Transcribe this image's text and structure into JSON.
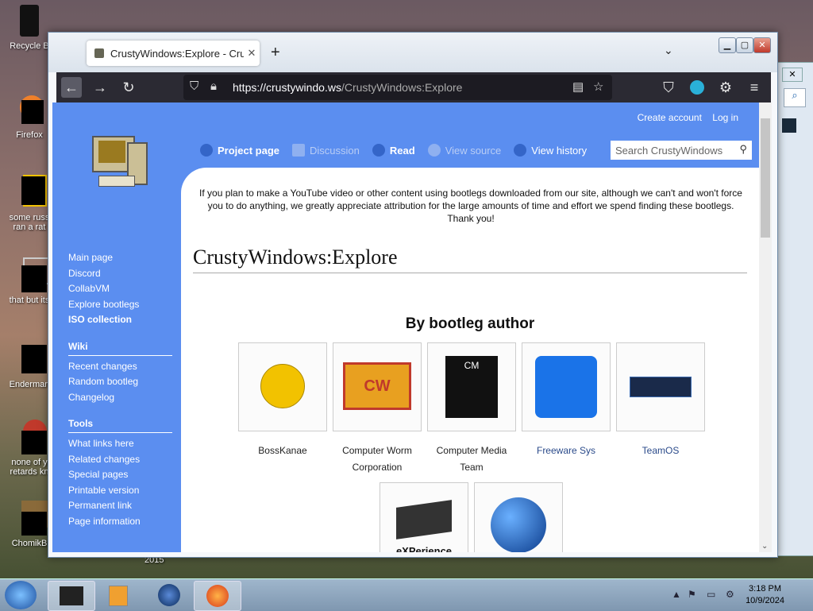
{
  "desktop": {
    "icons": [
      {
        "label": "Recycle B"
      },
      {
        "label": "Firefox"
      },
      {
        "label": "some russ ran a rat"
      },
      {
        "label": "that but its"
      },
      {
        "label": "Enderman"
      },
      {
        "label": "none of y retards kn"
      },
      {
        "label": "ChomikB"
      }
    ],
    "year_label": "2015"
  },
  "browser": {
    "tab_title": "CrustyWindows:Explore - Crust",
    "tab_close": "✕",
    "new_tab": "+",
    "list_tabs": "⌄",
    "url_host": "https://crustywindo.ws",
    "url_path": "/CrustyWindows:Explore"
  },
  "site": {
    "top_links": [
      "Create account",
      "Log in"
    ],
    "page_tabs": [
      {
        "label": "Project page"
      },
      {
        "label": "Discussion"
      },
      {
        "label": "Read"
      },
      {
        "label": "View source"
      },
      {
        "label": "View history"
      }
    ],
    "search_placeholder": "Search CrustyWindows",
    "sidebar": {
      "main": [
        "Main page",
        "Discord",
        "CollabVM",
        "Explore bootlegs",
        "ISO collection"
      ],
      "wiki_heading": "Wiki",
      "wiki": [
        "Recent changes",
        "Random bootleg",
        "Changelog"
      ],
      "tools_heading": "Tools",
      "tools": [
        "What links here",
        "Related changes",
        "Special pages",
        "Printable version",
        "Permanent link",
        "Page information"
      ]
    },
    "notice": "If you plan to make a YouTube video or other content using bootlegs downloaded from our site, although we can't and won't force you to do anything, we greatly appreciate attribution for the large amounts of time and effort we spend finding these bootlegs. Thank you!",
    "title": "CrustyWindows:Explore",
    "section": "By bootleg author",
    "authors": [
      {
        "name": "BossKanae"
      },
      {
        "name": "Computer Worm Corporation",
        "art": "CW"
      },
      {
        "name": "Computer Media Team",
        "art": "CM"
      },
      {
        "name": "Freeware Sys"
      },
      {
        "name": "TeamOS"
      }
    ],
    "authors_row2": [
      {
        "name": "eXPerience",
        "art": "eXPerience"
      },
      {
        "name": "",
        "art": ""
      }
    ]
  },
  "taskbar": {
    "time": "3:18 PM",
    "date": "10/9/2024"
  }
}
